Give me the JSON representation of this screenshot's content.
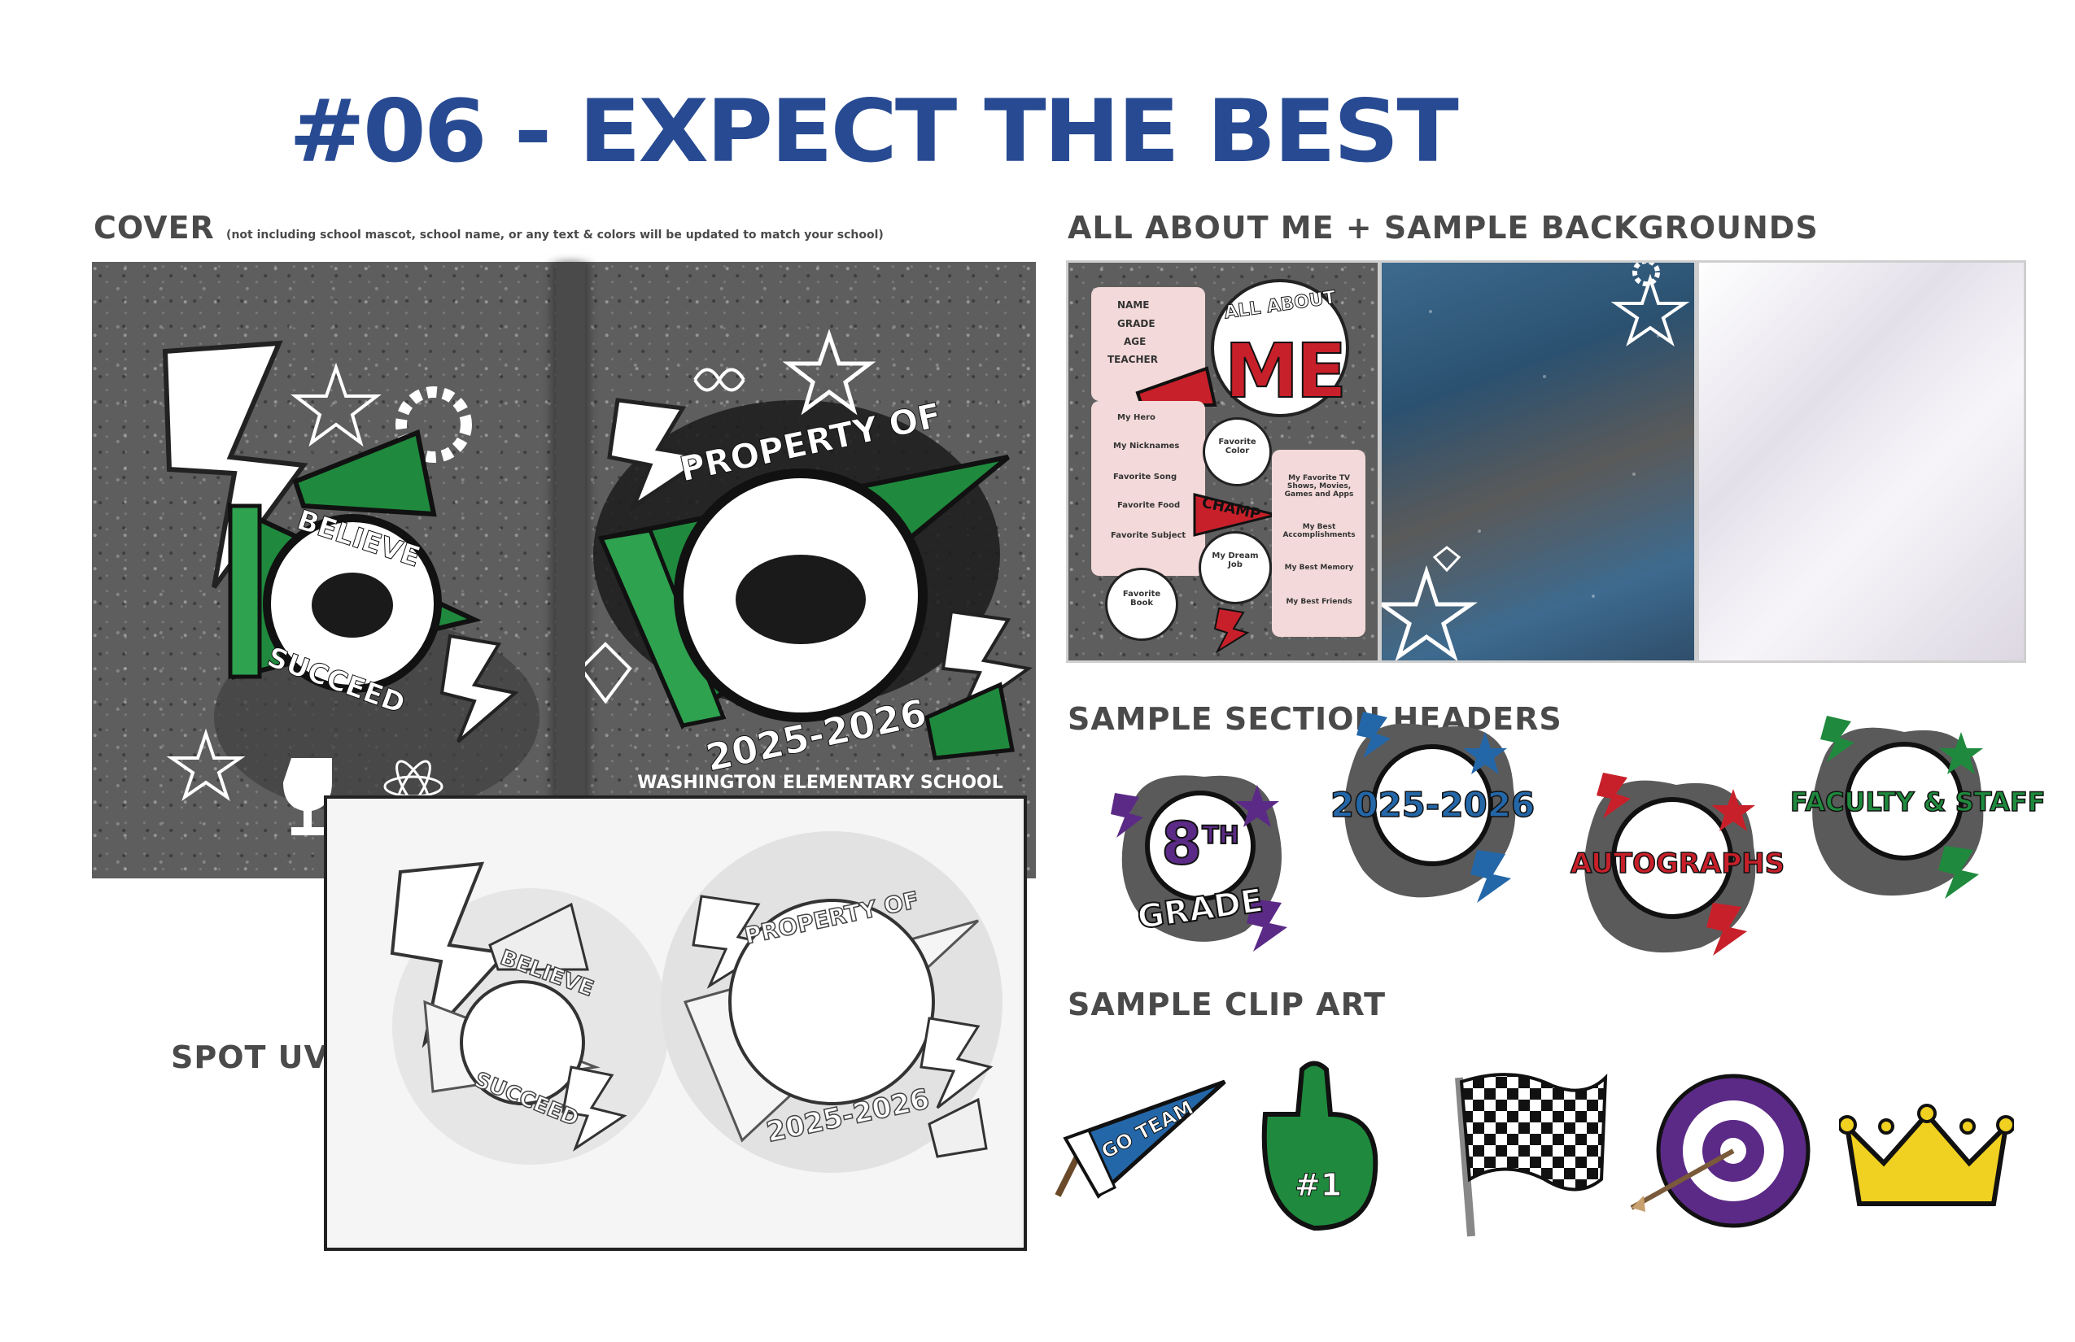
{
  "title": "#06 - EXPECT THE BEST",
  "cover": {
    "heading_bold": "COVER",
    "heading_note": "(not including school mascot, school name, or any text & colors will be updated to match your school)",
    "back": {
      "top_text": "BELIEVE",
      "bottom_text": "SUCCEED"
    },
    "front": {
      "top_text": "PROPERTY OF",
      "year": "2025-2026",
      "school": "WASHINGTON ELEMENTARY SCHOOL"
    }
  },
  "spot_uv": {
    "label": "SPOT UV",
    "back": {
      "top_text": "BELIEVE",
      "bottom_text": "SUCCEED"
    },
    "front": {
      "top_text": "PROPERTY OF",
      "year": "2025-2026"
    }
  },
  "all_about_me": {
    "heading": "ALL ABOUT ME + SAMPLE BACKGROUNDS",
    "banner_top": "ALL ABOUT",
    "banner_big": "ME",
    "fields_top": [
      "NAME",
      "GRADE",
      "AGE",
      "TEACHER"
    ],
    "fields_left": [
      "My Hero",
      "My Nicknames",
      "Favorite Song",
      "Favorite Food",
      "Favorite Subject"
    ],
    "fields_right": [
      "My Favorite TV Shows, Movies, Games and Apps",
      "My Best Accomplishments",
      "My Best Memory",
      "My Best Friends"
    ],
    "circle_labels": {
      "color": "Favorite Color",
      "book": "Favorite Book",
      "dream": "My Dream Job"
    },
    "pennant": "CHAMP"
  },
  "section_headers": {
    "heading": "SAMPLE SECTION HEADERS",
    "items": [
      {
        "line1": "8",
        "sup": "TH",
        "line2": "GRADE",
        "color": "#5b2a86"
      },
      {
        "line1": "2025-2026",
        "color": "#2467a8"
      },
      {
        "line1": "AUTOGRAPHS",
        "color": "#c8202a"
      },
      {
        "line1": "FACULTY & STAFF",
        "color": "#1f8a3d"
      }
    ]
  },
  "clip_art": {
    "heading": "SAMPLE CLIP ART",
    "pennant_text": "GO TEAM",
    "finger_text": "#1"
  },
  "colors": {
    "title": "#274a92",
    "green": "#1f8a3d",
    "purple": "#5b2a86",
    "red": "#c8202a",
    "blue": "#2467a8",
    "yellow": "#f0d020"
  }
}
